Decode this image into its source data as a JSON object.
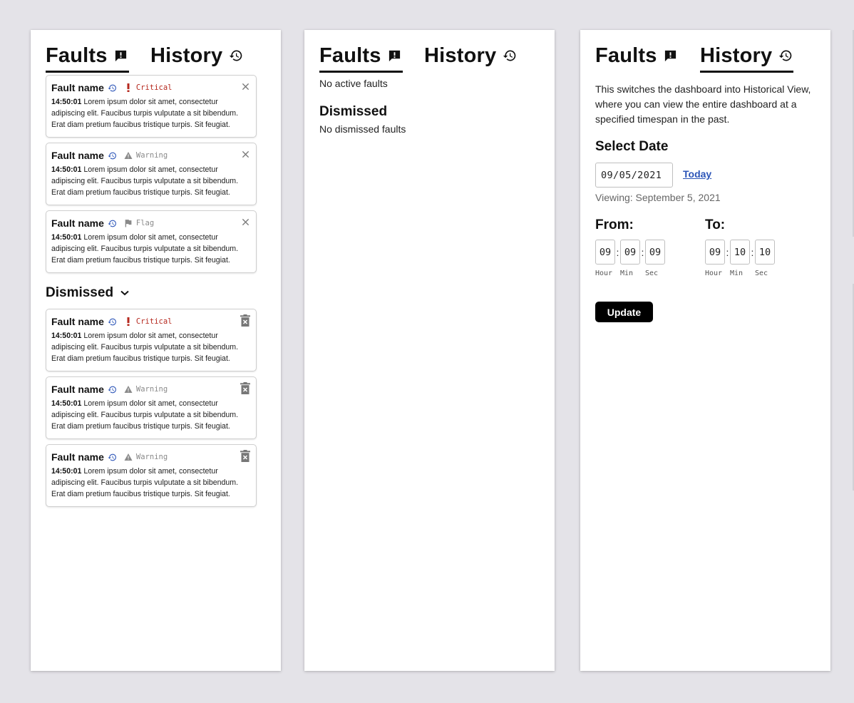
{
  "tabs": {
    "faults_label": "Faults",
    "history_label": "History"
  },
  "active_faults": [
    {
      "name": "Fault name",
      "severity": "Critical",
      "time": "14:50:01",
      "description": "Lorem ipsum dolor sit amet, consectetur adipiscing elit. Faucibus turpis vulputate a sit bibendum. Erat diam pretium faucibus tristique turpis. Sit feugiat."
    },
    {
      "name": "Fault name",
      "severity": "Warning",
      "time": "14:50:01",
      "description": "Lorem ipsum dolor sit amet, consectetur adipiscing elit. Faucibus turpis vulputate a sit bibendum. Erat diam pretium faucibus tristique turpis. Sit feugiat."
    },
    {
      "name": "Fault name",
      "severity": "Flag",
      "time": "14:50:01",
      "description": "Lorem ipsum dolor sit amet, consectetur adipiscing elit. Faucibus turpis vulputate a sit bibendum. Erat diam pretium faucibus tristique turpis. Sit feugiat."
    }
  ],
  "dismissed_heading": "Dismissed",
  "dismissed_faults": [
    {
      "name": "Fault name",
      "severity": "Critical",
      "time": "14:50:01",
      "description": "Lorem ipsum dolor sit amet, consectetur adipiscing elit. Faucibus turpis vulputate a sit bibendum. Erat diam pretium faucibus tristique turpis. Sit feugiat."
    },
    {
      "name": "Fault name",
      "severity": "Warning",
      "time": "14:50:01",
      "description": "Lorem ipsum dolor sit amet, consectetur adipiscing elit. Faucibus turpis vulputate a sit bibendum. Erat diam pretium faucibus tristique turpis. Sit feugiat."
    },
    {
      "name": "Fault name",
      "severity": "Warning",
      "time": "14:50:01",
      "description": "Lorem ipsum dolor sit amet, consectetur adipiscing elit. Faucibus turpis vulputate a sit bibendum. Erat diam pretium faucibus tristique turpis. Sit feugiat."
    }
  ],
  "empty_state": {
    "no_active": "No active faults",
    "dismissed_heading": "Dismissed",
    "no_dismissed": "No dismissed faults"
  },
  "history": {
    "description": "This switches the dashboard into Historical View, where you can view the entire dashboard at a specified timespan in the past.",
    "select_date_heading": "Select Date",
    "date_value": "09/05/2021",
    "today_link": "Today",
    "viewing_text": "Viewing: September 5, 2021",
    "from_label": "From:",
    "to_label": "To:",
    "from_time": {
      "hour": "09",
      "min": "09",
      "sec": "09"
    },
    "to_time": {
      "hour": "09",
      "min": "10",
      "sec": "10"
    },
    "time_separator": ":",
    "unit_labels": {
      "hour": "Hour",
      "min": "Min",
      "sec": "Sec"
    },
    "update_button": "Update"
  },
  "colors": {
    "critical": "#b5281e",
    "muted": "#8a8a8a",
    "link": "#2c55b8",
    "history_icon": "#2c55b8",
    "background": "#e4e3e8"
  },
  "icons": {
    "faults_tab": "feedback-icon",
    "history_tab": "history-icon",
    "critical": "exclamation-icon",
    "warning": "warning-triangle-icon",
    "flag": "flag-icon",
    "dismiss": "close-icon",
    "delete": "trash-icon",
    "collapse": "chevron-down-icon"
  }
}
